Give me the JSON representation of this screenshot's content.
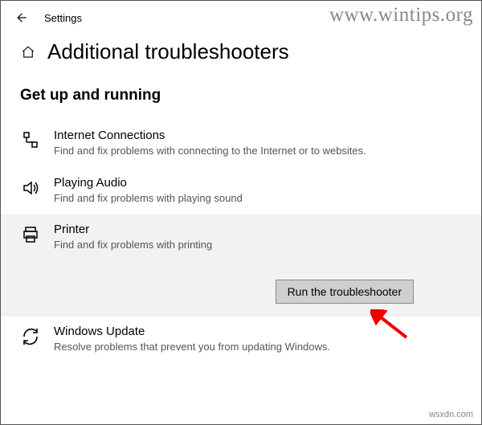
{
  "app": {
    "title": "Settings"
  },
  "watermark": "www.wintips.org",
  "page": {
    "title": "Additional troubleshooters"
  },
  "section": {
    "heading": "Get up and running"
  },
  "troubleshooters": [
    {
      "id": "internet",
      "title": "Internet Connections",
      "desc": "Find and fix problems with connecting to the Internet or to websites."
    },
    {
      "id": "audio",
      "title": "Playing Audio",
      "desc": "Find and fix problems with playing sound"
    },
    {
      "id": "printer",
      "title": "Printer",
      "desc": "Find and fix problems with printing"
    },
    {
      "id": "windowsupdate",
      "title": "Windows Update",
      "desc": "Resolve problems that prevent you from updating Windows."
    }
  ],
  "run_button": "Run the troubleshooter",
  "credit": "wsxdn.com"
}
